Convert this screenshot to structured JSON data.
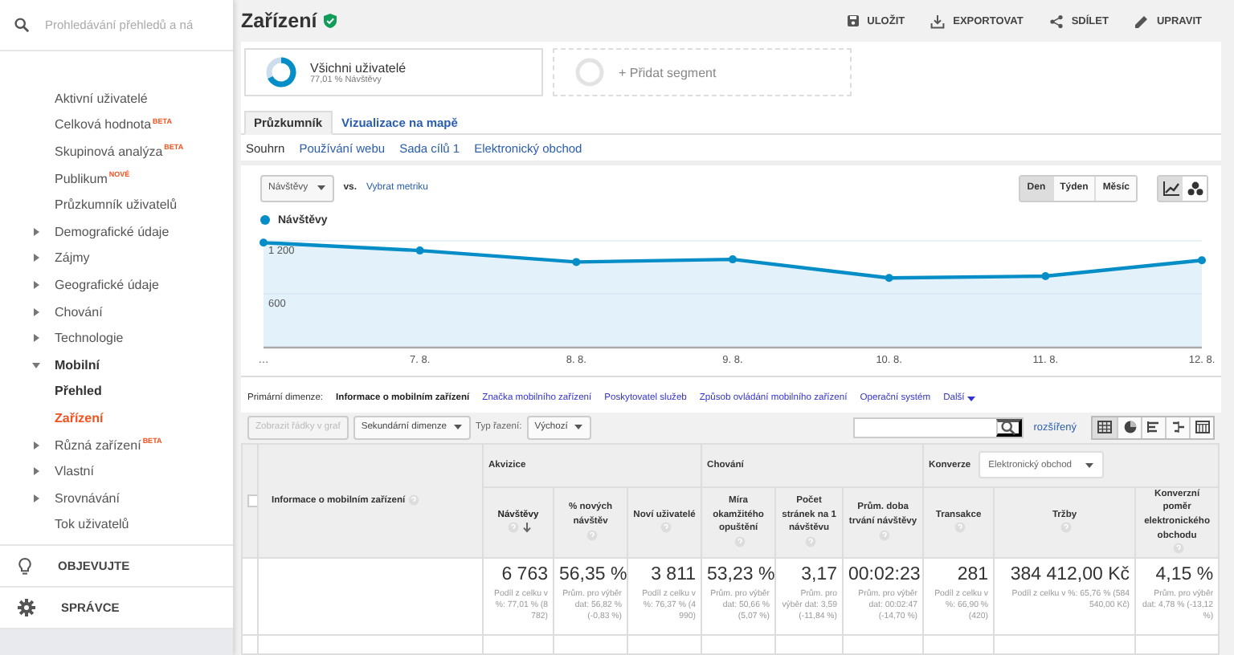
{
  "search": {
    "placeholder": "Prohledávání přehledů a ná"
  },
  "sidebar": {
    "items": [
      {
        "label": "Aktivní uživatelé"
      },
      {
        "label": "Celková hodnota",
        "badge": "BETA"
      },
      {
        "label": "Skupinová analýza",
        "badge": "BETA"
      },
      {
        "label": "Publikum",
        "badge": "NOVÉ"
      },
      {
        "label": "Průzkumník uživatelů"
      },
      {
        "label": "Demografické údaje",
        "expanded": false
      },
      {
        "label": "Zájmy",
        "expanded": false
      },
      {
        "label": "Geografické údaje",
        "expanded": false
      },
      {
        "label": "Chování",
        "expanded": false
      },
      {
        "label": "Technologie",
        "expanded": false
      },
      {
        "label": "Mobilní",
        "expanded": true,
        "children": [
          {
            "label": "Přehled",
            "selected": false
          },
          {
            "label": "Zařízení",
            "selected": true
          }
        ]
      },
      {
        "label": "Různá zařízení",
        "badge": "BETA",
        "expanded": false
      },
      {
        "label": "Vlastní",
        "expanded": false
      },
      {
        "label": "Srovnávání",
        "expanded": false
      },
      {
        "label": "Tok uživatelů"
      }
    ]
  },
  "bottom_nav": [
    {
      "label": "OBJEVUJTE",
      "kind": "bulb"
    },
    {
      "label": "SPRÁVCE",
      "kind": "gear"
    }
  ],
  "header": {
    "title": "Zařízení",
    "actions": [
      {
        "label": "ULOŽIT",
        "kind": "save"
      },
      {
        "label": "EXPORTOVAT",
        "kind": "export"
      },
      {
        "label": "SDÍLET",
        "kind": "share"
      },
      {
        "label": "UPRAVIT",
        "kind": "edit"
      }
    ]
  },
  "segments": [
    {
      "kind": "active",
      "name": "Všichni uživatelé",
      "detail": "77,01 % Návštěvy"
    },
    {
      "kind": "add",
      "name": "+ Přidat segment"
    }
  ],
  "tabs": [
    {
      "label": "Průzkumník",
      "selected": true
    },
    {
      "label": "Vizualizace na mapě",
      "selected": false
    }
  ],
  "subtabs": [
    {
      "label": "Souhrn",
      "selected": true
    },
    {
      "label": "Používání webu",
      "selected": false
    },
    {
      "label": "Sada cílů 1",
      "selected": false
    },
    {
      "label": "Elektronický obchod",
      "selected": false
    }
  ],
  "chart_controls": {
    "metric": "Návštěvy",
    "vs": "vs.",
    "other_metric": "Vybrat metriku",
    "periods": [
      {
        "label": "Den",
        "selected": true
      },
      {
        "label": "Týden",
        "selected": false
      },
      {
        "label": "Měsíc",
        "selected": false
      }
    ],
    "chart_types": [
      {
        "kind": "line",
        "selected": true
      },
      {
        "kind": "motion",
        "selected": false
      }
    ]
  },
  "chart_data": {
    "type": "area",
    "categories": [
      "…",
      "7. 8.",
      "8. 8.",
      "9. 8.",
      "10. 8.",
      "11. 8.",
      "12. 8."
    ],
    "yticks": [
      {
        "value": 600,
        "label": "600"
      },
      {
        "value": 1200,
        "label": "1 200"
      }
    ],
    "ylim": [
      0,
      1200
    ],
    "series": [
      {
        "name": "Návštěvy",
        "color": "#058dc7",
        "marker": "circle",
        "values": [
          1180,
          1090,
          960,
          990,
          780,
          800,
          980
        ]
      }
    ]
  },
  "dimensions": {
    "label": "Primární dimenze:",
    "items": [
      {
        "label": "Informace o mobilním zařízení",
        "selected": true
      },
      {
        "label": "Značka mobilního zařízení",
        "selected": false
      },
      {
        "label": "Poskytovatel služeb",
        "selected": false
      },
      {
        "label": "Způsob ovládání mobilního zařízení",
        "selected": false
      },
      {
        "label": "Operační systém",
        "selected": false
      }
    ],
    "more": "Další"
  },
  "toolbar": {
    "plot_rows": "Zobrazit řádky v graf",
    "secondary": "Sekundární dimenze",
    "sort_label": "Typ řazení:",
    "sort": "Výchozí",
    "advanced": "rozšířený",
    "views": [
      {
        "kind": "table",
        "selected": true
      },
      {
        "kind": "pie",
        "selected": false
      },
      {
        "kind": "bars",
        "selected": false
      },
      {
        "kind": "compare",
        "selected": false
      },
      {
        "kind": "pivot",
        "selected": false
      }
    ]
  },
  "table": {
    "select_all": {
      "checked": false
    },
    "dimension": "Informace o mobilním zařízení",
    "groups": [
      {
        "label": "Akvizice",
        "columns": [
          {
            "label": "Návštěvy",
            "sorted": true,
            "value": "6 763",
            "note": "Podíl z celku v %: 77,01 % (8 782)"
          },
          {
            "label": "% nových návštěv",
            "sorted": false,
            "value": "56,35 %",
            "note": "Prům. pro výběr dat: 56,82 % (-0,83 %)"
          },
          {
            "label": "Noví uživatelé",
            "sorted": false,
            "value": "3 811",
            "note": "Podíl z celku v %: 76,37 % (4 990)"
          }
        ]
      },
      {
        "label": "Chování",
        "columns": [
          {
            "label": "Míra okamžitého opuštění",
            "sorted": false,
            "value": "53,23 %",
            "note": "Prům. pro výběr dat: 50,66 % (5,07 %)"
          },
          {
            "label": "Počet stránek na 1 návštěvu",
            "sorted": false,
            "value": "3,17",
            "note": "Prům. pro výběr dat: 3,59 (-11,84 %)"
          },
          {
            "label": "Prům. doba trvání návštěvy",
            "sorted": false,
            "value": "00:02:23",
            "note": "Prům. pro výběr dat: 00:02:47 (-14,70 %)"
          }
        ]
      },
      {
        "label": "Konverze",
        "dropdown": "Elektronický obchod",
        "columns": [
          {
            "label": "Transakce",
            "sorted": false,
            "value": "281",
            "note": "Podíl z celku v %: 66,90 % (420)"
          },
          {
            "label": "Tržby",
            "sorted": false,
            "value": "384 412,00 Kč",
            "note": "Podíl z celku v %: 65,76 % (584 540,00 Kč)"
          },
          {
            "label": "Konverzní poměr elektronického obchodu",
            "sorted": false,
            "value": "4,15 %",
            "note": "Prům. pro výběr dat: 4,78 % (-13,12 %)"
          }
        ]
      }
    ]
  }
}
